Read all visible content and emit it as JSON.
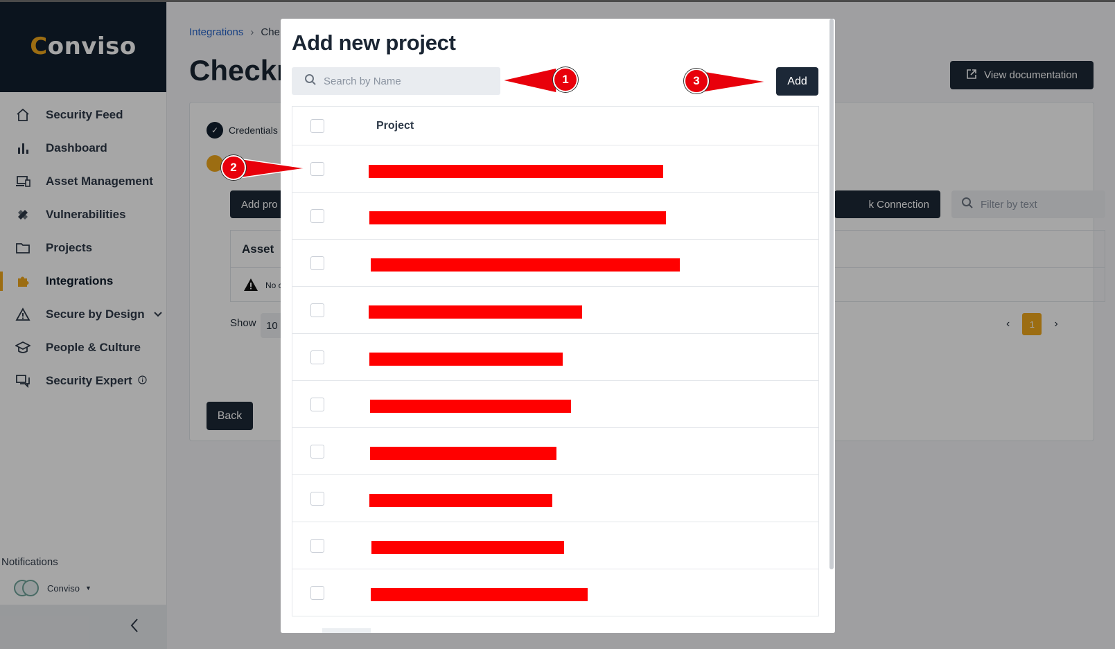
{
  "sidebar": {
    "logo": {
      "prefix": "C",
      "rest": "onviso"
    },
    "items": [
      {
        "label": "Security Feed",
        "icon": "home-icon"
      },
      {
        "label": "Dashboard",
        "icon": "bar-chart-icon"
      },
      {
        "label": "Asset Management",
        "icon": "devices-icon"
      },
      {
        "label": "Vulnerabilities",
        "icon": "bandage-icon"
      },
      {
        "label": "Projects",
        "icon": "folder-icon"
      },
      {
        "label": "Integrations",
        "icon": "puzzle-icon",
        "active": true
      },
      {
        "label": "Secure by Design",
        "icon": "warning-icon"
      },
      {
        "label": "People & Culture",
        "icon": "graduation-cap-icon"
      },
      {
        "label": "Security Expert",
        "icon": "chat-icon"
      }
    ],
    "notifications_label": "Notifications",
    "org_name": "Conviso"
  },
  "page": {
    "breadcrumb": {
      "link": "Integrations",
      "current": "Che"
    },
    "title": "Checkm",
    "view_doc_label": "View documentation",
    "step_credentials": "Credentials",
    "add_projects_label": "Add pro",
    "check_connection_label": "k Connection",
    "filter_placeholder": "Filter by text",
    "table_header_asset": "Asset",
    "empty_text": "No c",
    "show_label": "Show",
    "show_value": "10",
    "current_page": "1",
    "back_label": "Back"
  },
  "modal": {
    "title": "Add new project",
    "search_placeholder": "Search by Name",
    "add_label": "Add",
    "column_project": "Project",
    "row_count": 10
  },
  "annotations": [
    "1",
    "2",
    "3"
  ],
  "colors": {
    "brand_dark": "#12202f",
    "accent": "#f0a81c",
    "annotation_red": "#e8000b",
    "redaction": "#ff0000"
  }
}
